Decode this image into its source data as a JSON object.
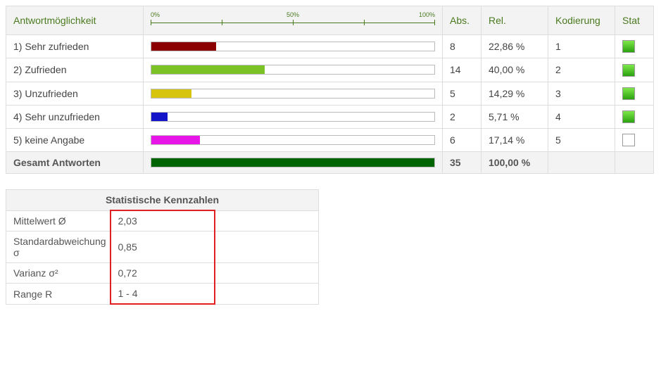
{
  "headers": {
    "answer": "Antwortmöglichkeit",
    "abs": "Abs.",
    "rel": "Rel.",
    "coding": "Kodierung",
    "stat": "Stat"
  },
  "axis": {
    "l0": "0%",
    "l50": "50%",
    "l100": "100%"
  },
  "rows": [
    {
      "label": "1) Sehr zufrieden",
      "abs": "8",
      "rel": "22,86 %",
      "coding": "1",
      "stat_on": true,
      "pct": 22.86,
      "fill": "fill-darkred"
    },
    {
      "label": "2) Zufrieden",
      "abs": "14",
      "rel": "40,00 %",
      "coding": "2",
      "stat_on": true,
      "pct": 40.0,
      "fill": "fill-lime"
    },
    {
      "label": "3) Unzufrieden",
      "abs": "5",
      "rel": "14,29 %",
      "coding": "3",
      "stat_on": true,
      "pct": 14.29,
      "fill": "fill-yellow"
    },
    {
      "label": "4) Sehr unzufrieden",
      "abs": "2",
      "rel": "5,71 %",
      "coding": "4",
      "stat_on": true,
      "pct": 5.71,
      "fill": "fill-blue"
    },
    {
      "label": "5) keine Angabe",
      "abs": "6",
      "rel": "17,14 %",
      "coding": "5",
      "stat_on": false,
      "pct": 17.14,
      "fill": "fill-magenta"
    }
  ],
  "total": {
    "label": "Gesamt Antworten",
    "abs": "35",
    "rel": "100,00 %",
    "pct": 100.0,
    "fill": "fill-darkgreen"
  },
  "stats": {
    "title": "Statistische Kennzahlen",
    "items": [
      {
        "label": "Mittelwert Ø",
        "value": "2,03"
      },
      {
        "label": "Standardabweichung σ",
        "value": "0,85"
      },
      {
        "label": "Varianz σ²",
        "value": "0,72"
      },
      {
        "label": "Range R",
        "value": "1 - 4"
      }
    ]
  },
  "chart_data": {
    "type": "bar",
    "title": "",
    "xlabel": "",
    "ylabel": "",
    "xlim": [
      0,
      100
    ],
    "categories": [
      "1) Sehr zufrieden",
      "2) Zufrieden",
      "3) Unzufrieden",
      "4) Sehr unzufrieden",
      "5) keine Angabe"
    ],
    "series": [
      {
        "name": "Rel.",
        "values": [
          22.86,
          40.0,
          14.29,
          5.71,
          17.14
        ]
      }
    ],
    "abs_counts": [
      8,
      14,
      5,
      2,
      6
    ],
    "n_total": 35
  }
}
